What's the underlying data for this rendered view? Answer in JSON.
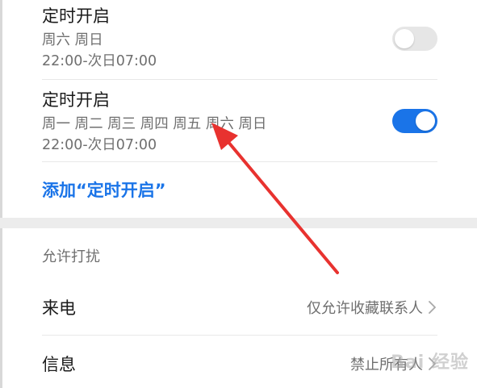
{
  "schedules": [
    {
      "title": "定时开启",
      "days": "周六 周日",
      "time": "22:00-次日07:00",
      "enabled": false
    },
    {
      "title": "定时开启",
      "days": "周一 周二 周三 周四 周五 周六 周日",
      "time": "22:00-次日07:00",
      "enabled": true
    }
  ],
  "add_schedule_label": "添加“定时开启”",
  "allow_section": {
    "header": "允许打扰",
    "calls": {
      "label": "来电",
      "value": "仅允许收藏联系人"
    },
    "messages": {
      "label": "信息",
      "value": "禁止所有人"
    }
  },
  "watermark_text": "Bai 经验",
  "colors": {
    "accent": "#1a74e8",
    "annotation_arrow": "#e8322f"
  },
  "icons": {
    "chevron": "chevron-right-icon"
  }
}
